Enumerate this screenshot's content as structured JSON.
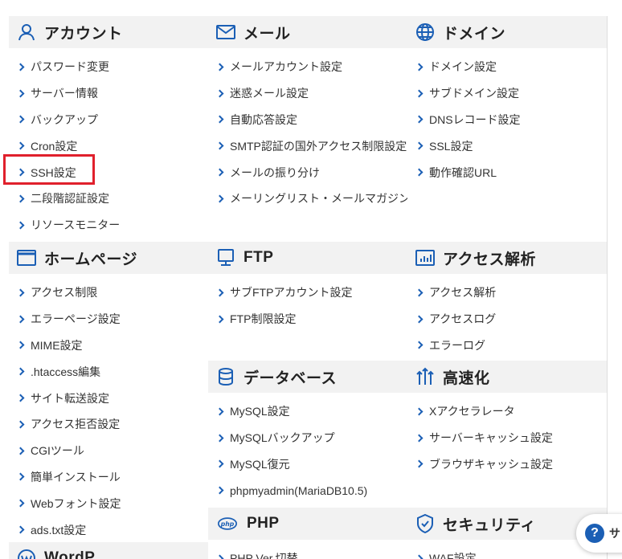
{
  "sections": {
    "account": {
      "title": "アカウント",
      "icon": "user-icon",
      "items": [
        "パスワード変更",
        "サーバー情報",
        "バックアップ",
        "Cron設定",
        "SSH設定",
        "二段階認証設定",
        "リソースモニター"
      ]
    },
    "mail": {
      "title": "メール",
      "icon": "mail-icon",
      "items": [
        "メールアカウント設定",
        "迷惑メール設定",
        "自動応答設定",
        "SMTP認証の国外アクセス制限設定",
        "メールの振り分け",
        "メーリングリスト・メールマガジン"
      ]
    },
    "domain": {
      "title": "ドメイン",
      "icon": "globe-icon",
      "items": [
        "ドメイン設定",
        "サブドメイン設定",
        "DNSレコード設定",
        "SSL設定",
        "動作確認URL"
      ]
    },
    "homepage": {
      "title": "ホームページ",
      "icon": "browser-window-icon",
      "items": [
        "アクセス制限",
        "エラーページ設定",
        "MIME設定",
        ".htaccess編集",
        "サイト転送設定",
        "アクセス拒否設定",
        "CGIツール",
        "簡単インストール",
        "Webフォント設定",
        "ads.txt設定"
      ]
    },
    "ftp": {
      "title": "FTP",
      "icon": "monitor-icon",
      "items": [
        "サブFTPアカウント設定",
        "FTP制限設定"
      ]
    },
    "analytics": {
      "title": "アクセス解析",
      "icon": "bar-chart-icon",
      "items": [
        "アクセス解析",
        "アクセスログ",
        "エラーログ"
      ]
    },
    "database": {
      "title": "データベース",
      "icon": "database-icon",
      "items": [
        "MySQL設定",
        "MySQLバックアップ",
        "MySQL復元",
        "phpmyadmin(MariaDB10.5)"
      ]
    },
    "speed": {
      "title": "高速化",
      "icon": "speed-arrows-icon",
      "items": [
        "Xアクセラレータ",
        "サーバーキャッシュ設定",
        "ブラウザキャッシュ設定"
      ]
    },
    "php": {
      "title": "PHP",
      "icon": "php-icon",
      "items": [
        "PHP Ver.切替"
      ]
    },
    "security": {
      "title": "セキュリティ",
      "icon": "shield-check-icon",
      "items": [
        "WAF設定"
      ]
    },
    "wordpress": {
      "title": "WordP",
      "icon": "wordpress-icon"
    }
  },
  "help": {
    "label": "サ",
    "icon": "question-icon"
  },
  "colors": {
    "accent": "#1b5fb5",
    "highlight": "#e0202c",
    "header_bg": "#f2f2f2",
    "border": "#dedede"
  }
}
